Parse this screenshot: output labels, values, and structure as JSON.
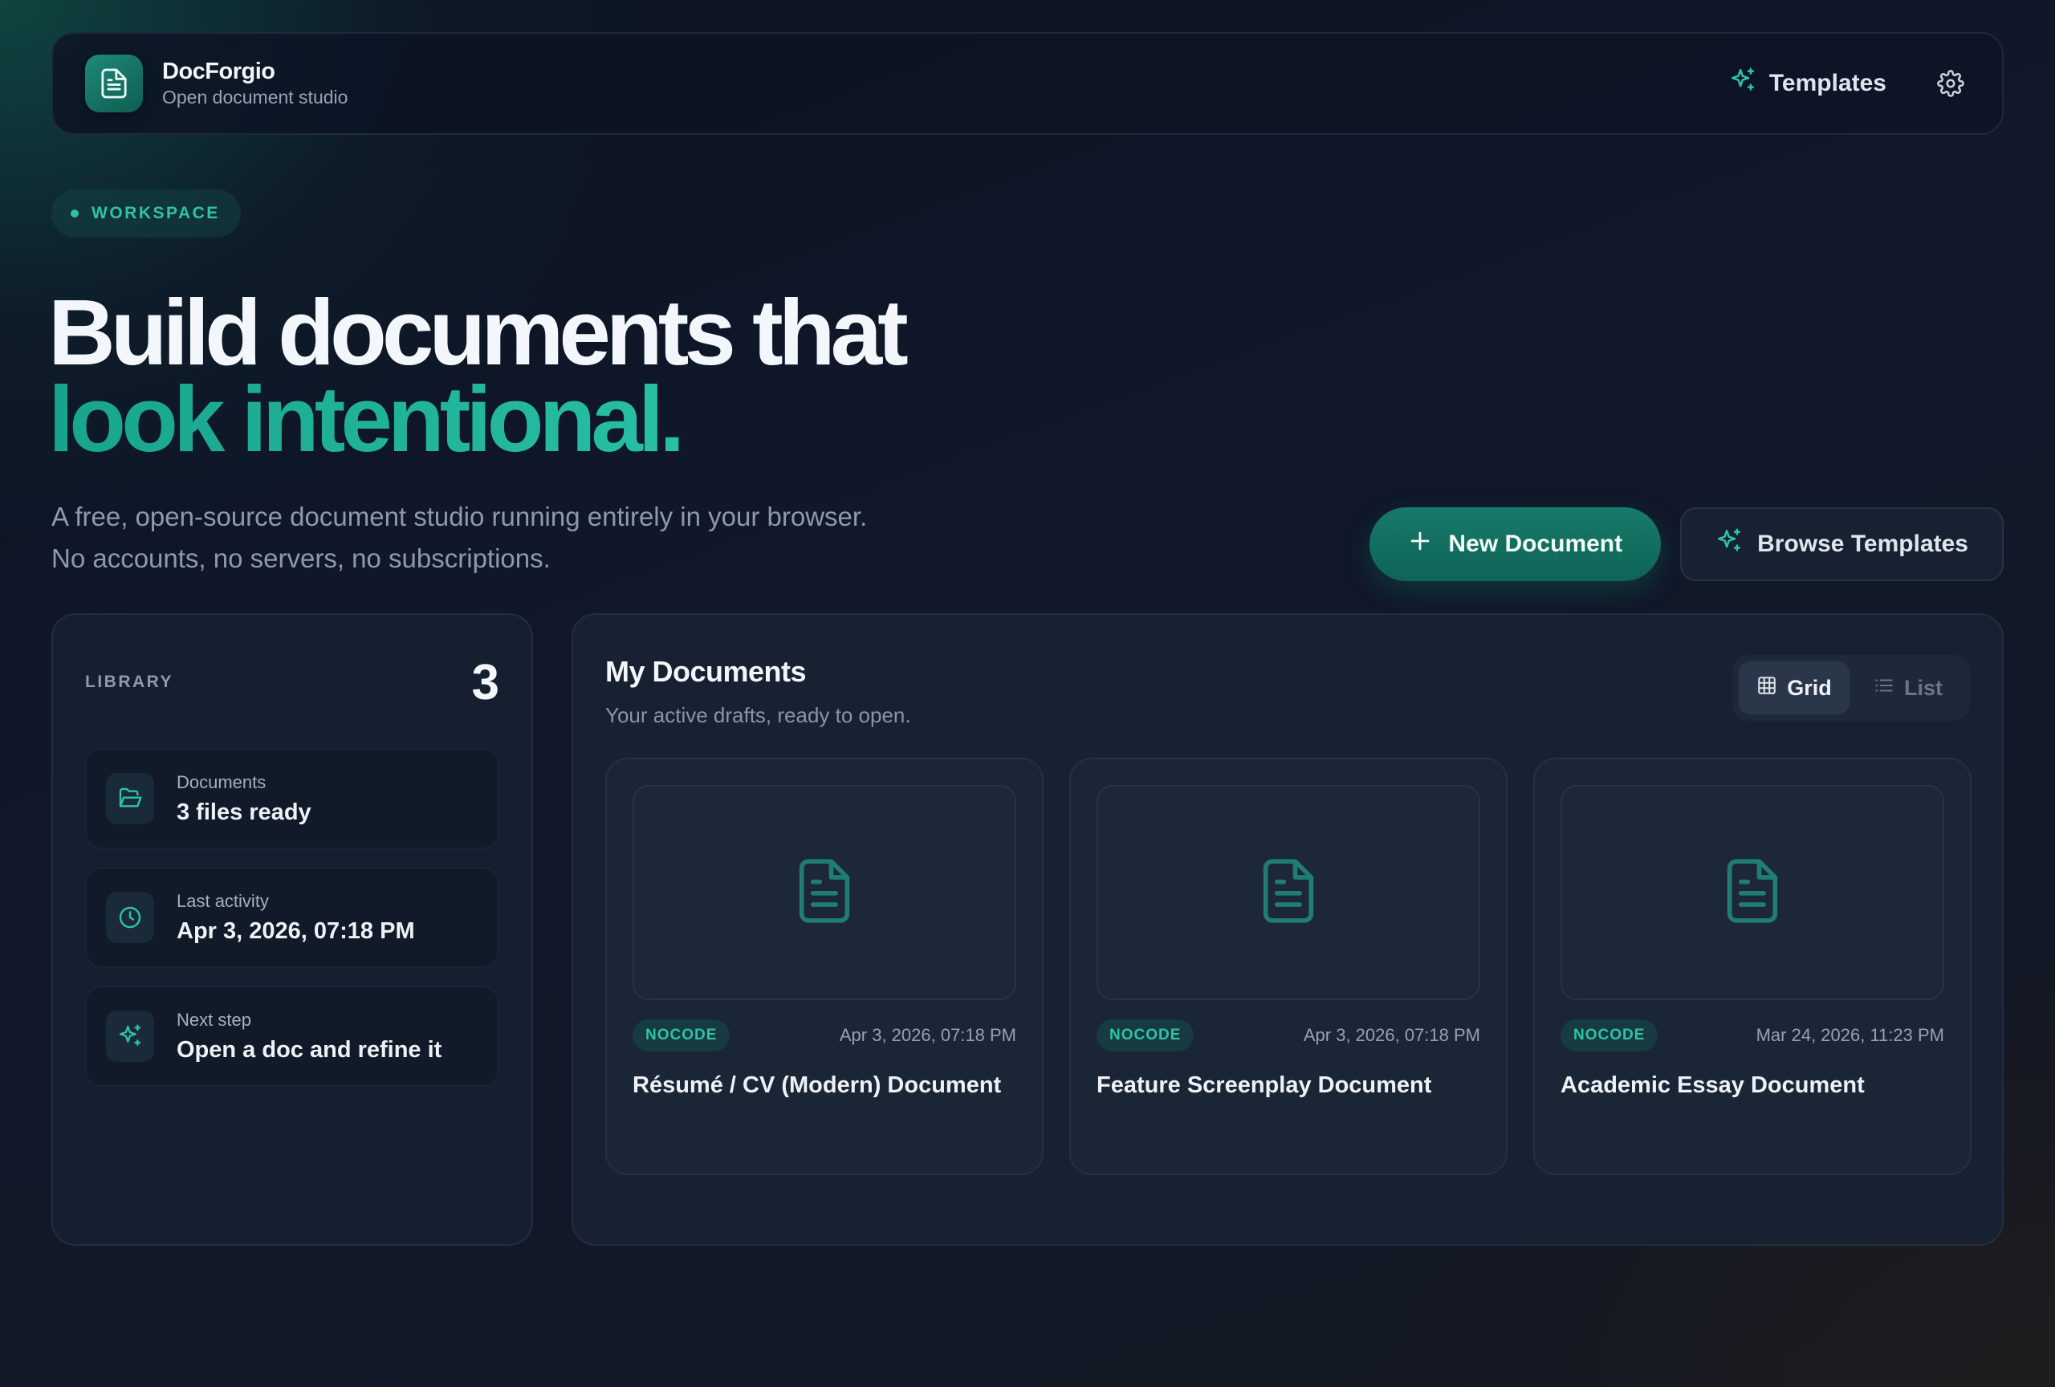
{
  "header": {
    "brand_name": "DocForgio",
    "brand_tagline": "Open document studio",
    "templates_label": "Templates",
    "logo_icon": "document-icon",
    "settings_icon": "gear-icon"
  },
  "hero": {
    "badge": "WORKSPACE",
    "title_line1": "Build documents that",
    "title_line2": "look intentional.",
    "subtitle": "A free, open-source document studio running entirely in your browser. No accounts, no servers, no subscriptions.",
    "primary_button": "New Document",
    "secondary_button": "Browse Templates"
  },
  "library": {
    "label": "LIBRARY",
    "count": "3",
    "items": [
      {
        "icon": "folder-open-icon",
        "label": "Documents",
        "value": "3 files ready"
      },
      {
        "icon": "clock-icon",
        "label": "Last activity",
        "value": "Apr 3, 2026, 07:18 PM"
      },
      {
        "icon": "sparkles-icon",
        "label": "Next step",
        "value": "Open a doc and refine it"
      }
    ]
  },
  "documents": {
    "title": "My Documents",
    "subtitle": "Your active drafts, ready to open.",
    "view_toggle": {
      "grid": "Grid",
      "list": "List",
      "selected": "Grid"
    },
    "cards": [
      {
        "tag": "NOCODE",
        "date": "Apr 3, 2026, 07:18 PM",
        "title": "Résumé / CV (Modern) Document"
      },
      {
        "tag": "NOCODE",
        "date": "Apr 3, 2026, 07:18 PM",
        "title": "Feature Screenplay Document"
      },
      {
        "tag": "NOCODE",
        "date": "Mar 24, 2026, 11:23 PM",
        "title": "Academic Essay Document"
      }
    ]
  },
  "colors": {
    "accent": "#2fc2a6",
    "primary_button": "#177a6a",
    "background": "#10182a"
  }
}
